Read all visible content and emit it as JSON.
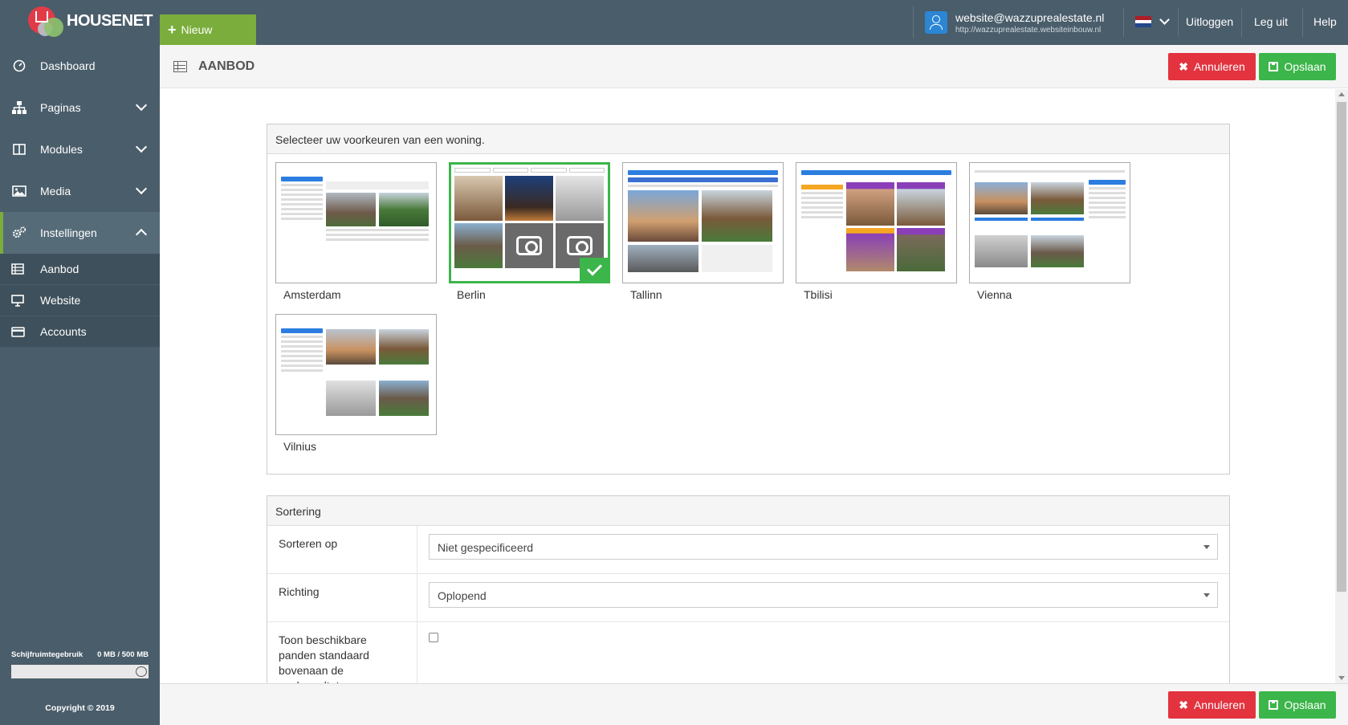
{
  "brand": {
    "name": "HOUSENET"
  },
  "topbar": {
    "new_label": "Nieuw",
    "user_email": "website@wazzuprealestate.nl",
    "user_url": "http://wazzuprealestate.websiteinbouw.nl",
    "logout_label": "Uitloggen",
    "leguit_label": "Leg uit",
    "help_label": "Help"
  },
  "sidebar": {
    "items": [
      {
        "label": "Dashboard",
        "icon": "dashboard-icon"
      },
      {
        "label": "Paginas",
        "icon": "sitemap-icon"
      },
      {
        "label": "Modules",
        "icon": "columns-icon"
      },
      {
        "label": "Media",
        "icon": "image-icon"
      },
      {
        "label": "Instellingen",
        "icon": "cogs-icon"
      }
    ],
    "subitems": [
      {
        "label": "Aanbod",
        "icon": "table-icon"
      },
      {
        "label": "Website",
        "icon": "monitor-icon"
      },
      {
        "label": "Accounts",
        "icon": "card-icon"
      }
    ],
    "disk_label": "Schijfruimtegebruik",
    "disk_value": "0 MB / 500 MB",
    "copyright": "Copyright © 2019"
  },
  "page": {
    "title": "AANBOD",
    "cancel_label": "Annuleren",
    "save_label": "Opslaan"
  },
  "templates": {
    "heading": "Selecteer uw voorkeuren van een woning.",
    "items": [
      {
        "name": "Amsterdam",
        "selected": false
      },
      {
        "name": "Berlin",
        "selected": true
      },
      {
        "name": "Tallinn",
        "selected": false
      },
      {
        "name": "Tbilisi",
        "selected": false
      },
      {
        "name": "Vienna",
        "selected": false
      },
      {
        "name": "Vilnius",
        "selected": false
      }
    ]
  },
  "sorting": {
    "heading": "Sortering",
    "sort_label": "Sorteren op",
    "sort_value": "Niet gespecificeerd",
    "direction_label": "Richting",
    "direction_value": "Oplopend",
    "available_label": "Toon beschikbare panden standaard bovenaan de zoekresultaten"
  },
  "colors": {
    "sidebar_bg": "#4a5d6a",
    "accent_green": "#7aad3b",
    "cancel_red": "#e2333f",
    "save_green": "#3cb54a"
  }
}
